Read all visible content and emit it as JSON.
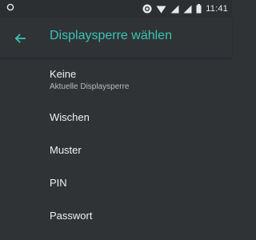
{
  "status_bar": {
    "time": "11:41",
    "icons": [
      "location-circle-icon",
      "vibrate-circle-icon",
      "wifi-icon",
      "signal-icon",
      "signal-icon-2",
      "battery-icon"
    ]
  },
  "toolbar": {
    "title": "Displaysperre wählen",
    "back_icon": "arrow-back-icon",
    "accent_color": "#3bc4b4"
  },
  "options": [
    {
      "label": "Keine",
      "sublabel": "Aktuelle Displaysperre"
    },
    {
      "label": "Wischen"
    },
    {
      "label": "Muster"
    },
    {
      "label": "PIN"
    },
    {
      "label": "Passwort"
    }
  ]
}
